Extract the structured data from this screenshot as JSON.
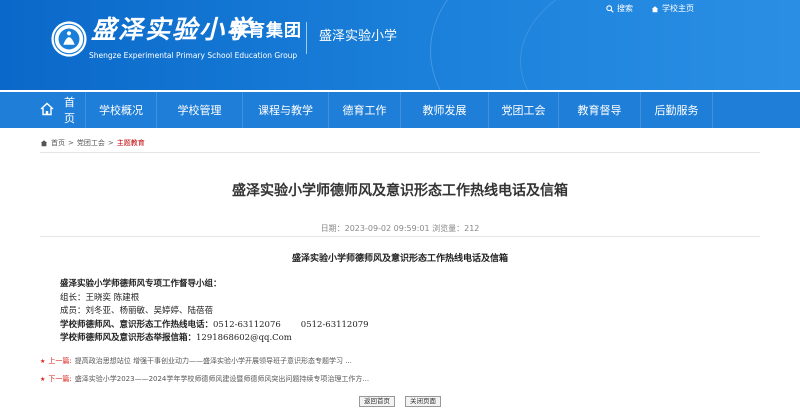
{
  "header": {
    "search_label": "搜索",
    "home_label": "学校主页",
    "calligraphy": "盛泽实验小学",
    "group_name": "教育集团",
    "english_name": "Shengze Experimental Primary School Education Group",
    "school_name": "盛泽实验小学"
  },
  "nav": {
    "items": [
      {
        "label": "首页",
        "icon": "home-icon"
      },
      {
        "label": "学校概况"
      },
      {
        "label": "学校管理"
      },
      {
        "label": "课程与教学"
      },
      {
        "label": "德育工作"
      },
      {
        "label": "教师发展"
      },
      {
        "label": "党团工会"
      },
      {
        "label": "教育督导"
      },
      {
        "label": "后勤服务"
      }
    ]
  },
  "breadcrumb": {
    "items": [
      "首页",
      "党团工会",
      "主题教育"
    ],
    "separator": ">"
  },
  "article": {
    "title": "盛泽实验小学师德师风及意识形态工作热线电话及信箱",
    "meta": "日期：2023-09-02 09:59:01  浏览量：212",
    "subtitle": "盛泽实验小学师德师风及意识形态工作热线电话及信箱",
    "lines": {
      "group_title": "盛泽实验小学师德师风专项工作督导小组：",
      "leader": "组长：王晓奕  陈建根",
      "members": "成员：刘冬亚、杨丽敏、吴婷婷、陆蓓蓓",
      "hotline_label": "学校师德师风、意识形态工作热线电话：",
      "hotline_1": "0512-63112076",
      "hotline_2": "0512-63112079",
      "mailbox_label": "学校师德师风及意识形态举报信箱：",
      "mailbox": "1291868602@qq.Com"
    }
  },
  "pager": {
    "prev_label": "上一篇:",
    "prev_title": "提高政治思想站位  增强干事创业动力——盛泽实验小学开展领导班子意识形态专题学习 ...",
    "next_label": "下一篇:",
    "next_title": "盛泽实验小学2023——2024学年学校师德师风建设暨师德师风突出问题持续专项治理工作方..."
  },
  "buttons": {
    "back": "返回首页",
    "close": "关闭页面"
  },
  "colors": {
    "banner": "#1a7fd9",
    "nav": "#1f7ed8",
    "accent_red": "#d9201a"
  }
}
